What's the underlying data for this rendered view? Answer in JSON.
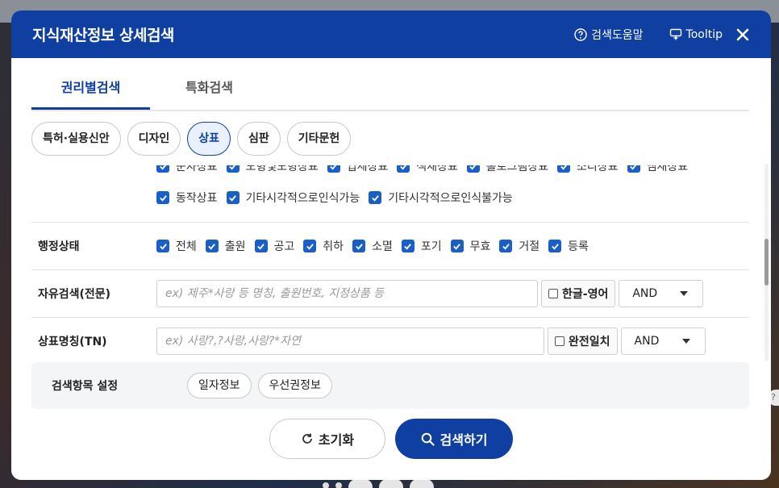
{
  "header": {
    "title": "지식재산정보 상세검색",
    "help_label": "검색도움말",
    "tooltip_label": "Tooltip"
  },
  "tabs": [
    {
      "label": "권리별검색",
      "active": true
    },
    {
      "label": "특화검색",
      "active": false
    }
  ],
  "chips": [
    {
      "label": "특허·실용신안",
      "active": false
    },
    {
      "label": "디자인",
      "active": false
    },
    {
      "label": "상표",
      "active": true
    },
    {
      "label": "심판",
      "active": false
    },
    {
      "label": "기타문헌",
      "active": false
    }
  ],
  "trademark_types": {
    "row1_cut": [
      "문자상표",
      "도형및도형상표",
      "입체상표",
      "색채상표",
      "홀로그램상표",
      "소리상표",
      "냄새상표"
    ],
    "row2": [
      "동작상표",
      "기타시각적으로인식가능",
      "기타시각적으로인식불가능"
    ]
  },
  "admin_status": {
    "label": "행정상태",
    "options": [
      "전체",
      "출원",
      "공고",
      "취하",
      "소멸",
      "포기",
      "무효",
      "거절",
      "등록"
    ]
  },
  "free_search": {
    "label": "자유검색(전문)",
    "placeholder": "ex) 제주*사랑 등 명칭, 출원번호, 지정상품 등",
    "toggle_label": "한글-영어",
    "operator": "AND"
  },
  "tm_name": {
    "label": "상표명칭(TN)",
    "placeholder": "ex) 사랑?,?사랑,사랑?*자연",
    "toggle_label": "완전일치",
    "operator": "AND"
  },
  "settings": {
    "label": "검색항목 설정",
    "pills": [
      "일자정보",
      "우선권정보"
    ]
  },
  "actions": {
    "reset_label": "초기화",
    "search_label": "검색하기"
  },
  "colors": {
    "primary": "#0e3fa1",
    "checkbox": "#1a5fc8"
  }
}
